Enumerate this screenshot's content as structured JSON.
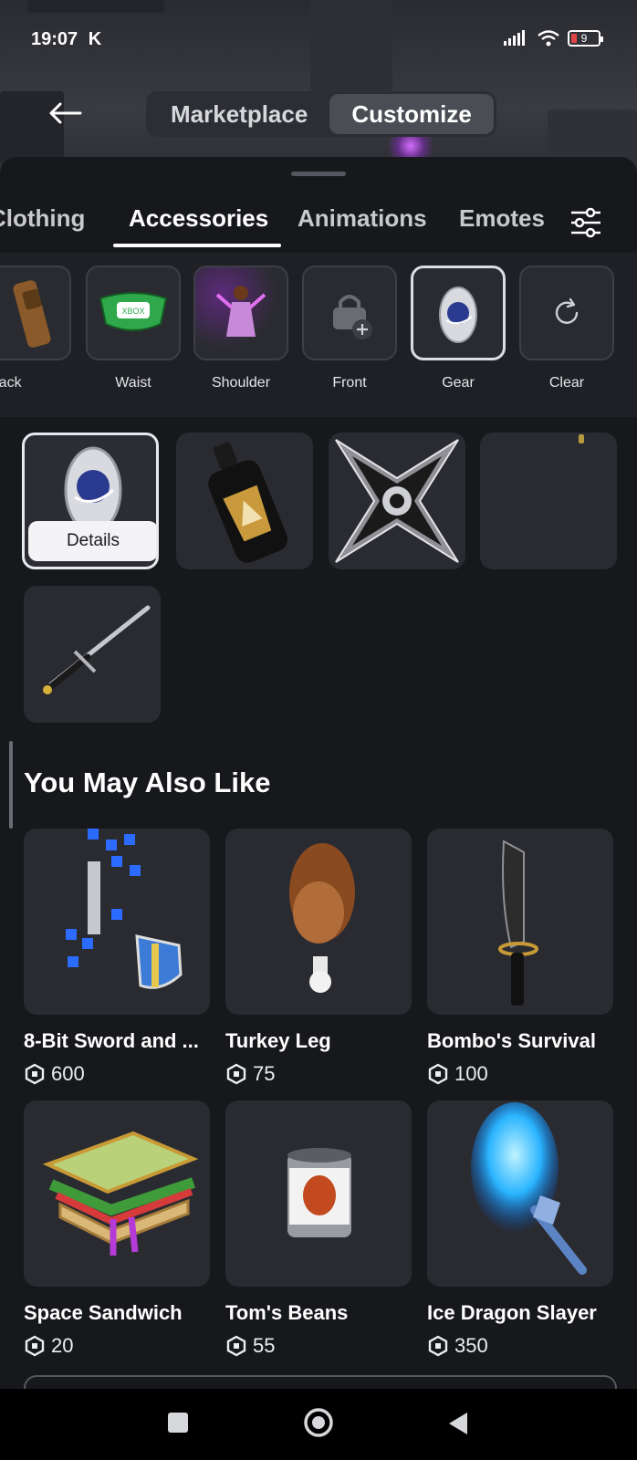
{
  "status": {
    "time": "19:07",
    "carrier_glyph": "K",
    "battery": "9",
    "battery_level": 0.09
  },
  "header": {
    "segments": [
      "Marketplace",
      "Customize"
    ],
    "active_segment": "Customize"
  },
  "tabs": [
    "Clothing",
    "Accessories",
    "Animations",
    "Emotes"
  ],
  "active_tab": "Accessories",
  "categories": [
    {
      "label": "Back",
      "icon": "backpack-icon"
    },
    {
      "label": "Waist",
      "icon": "waist-bag-icon"
    },
    {
      "label": "Shoulder",
      "icon": "fairy-icon"
    },
    {
      "label": "Front",
      "icon": "lock-plus-icon"
    },
    {
      "label": "Gear",
      "icon": "egg-badge-icon"
    },
    {
      "label": "Clear",
      "icon": "refresh-icon"
    }
  ],
  "selected_category": "Gear",
  "owned_items": [
    {
      "name": "egg-badge",
      "details_label": "Details"
    },
    {
      "name": "slate-bottle"
    },
    {
      "name": "shuriken"
    },
    {
      "name": "empty"
    },
    {
      "name": "sword"
    }
  ],
  "recommend": {
    "title": "You May Also Like",
    "items": [
      {
        "name": "8-Bit Sword and ...",
        "price": "600"
      },
      {
        "name": "Turkey Leg",
        "price": "75"
      },
      {
        "name": "Bombo's Survival",
        "price": "100"
      },
      {
        "name": "Space Sandwich",
        "price": "20"
      },
      {
        "name": "Tom's Beans",
        "price": "55"
      },
      {
        "name": "Ice Dragon Slayer",
        "price": "350"
      }
    ]
  },
  "colors": {
    "background": "#17181c",
    "tile": "#2a2b31",
    "accent": "#ffffff"
  }
}
